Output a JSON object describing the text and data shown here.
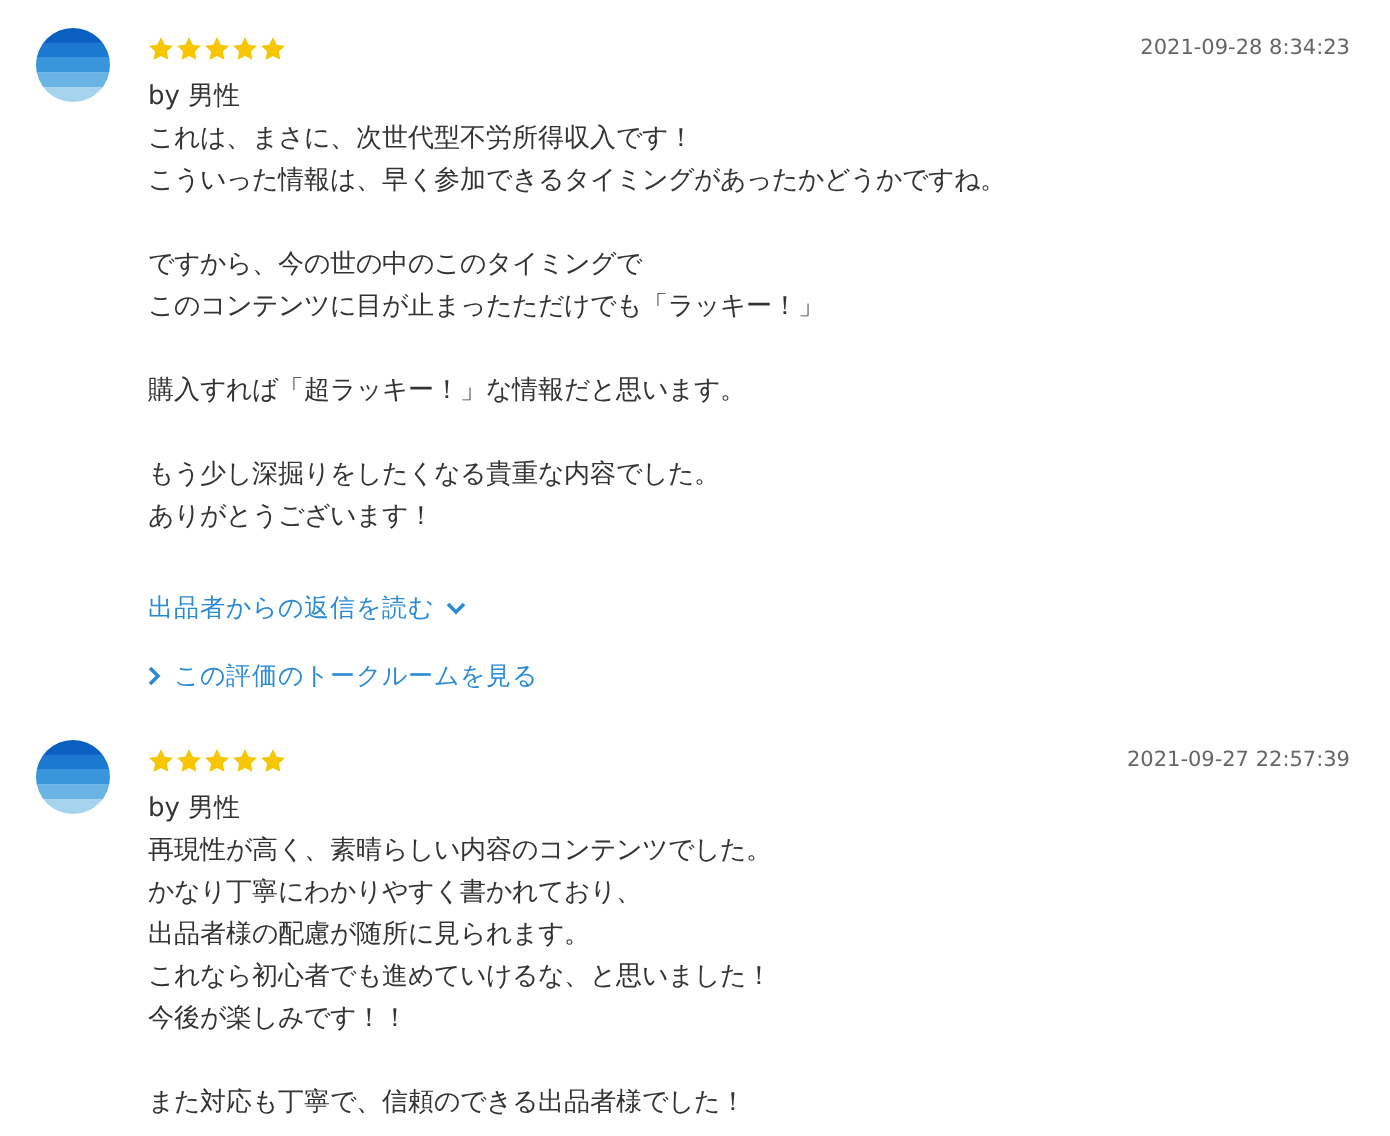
{
  "reviews": [
    {
      "stars": 5,
      "date": "2021-09-28 8:34:23",
      "author": "by 男性",
      "paragraphs": [
        [
          "これは、まさに、次世代型不労所得収入です！",
          "こういった情報は、早く参加できるタイミングがあったかどうかですね。"
        ],
        [
          "ですから、今の世の中のこのタイミングで",
          "このコンテンツに目が止まったただけでも「ラッキー！」"
        ],
        [
          "購入すれば「超ラッキー！」な情報だと思います。"
        ],
        [
          "もう少し深掘りをしたくなる貴重な内容でした。",
          "ありがとうございます！"
        ]
      ],
      "reply_link": "出品者からの返信を読む",
      "talkroom_link": "この評価のトークルームを見る"
    },
    {
      "stars": 5,
      "date": "2021-09-27 22:57:39",
      "author": "by 男性",
      "paragraphs": [
        [
          "再現性が高く、素晴らしい内容のコンテンツでした。",
          "かなり丁寧にわかりやすく書かれており、",
          "出品者様の配慮が随所に見られます。",
          "これなら初心者でも進めていけるな、と思いました！",
          "今後が楽しみです！！"
        ],
        [
          "また対応も丁寧で、信頼のできる出品者様でした！"
        ]
      ]
    }
  ]
}
